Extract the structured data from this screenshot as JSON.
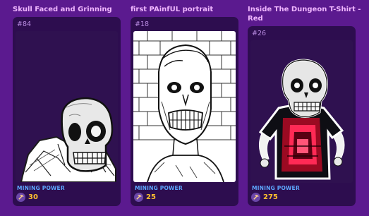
{
  "cards": [
    {
      "title": "Skull Faced and Grinning",
      "id": "#84",
      "mining_label": "MINING POWER",
      "mining_value": "30",
      "art": "skull-wrapped-in-cloth"
    },
    {
      "title": "first PAinfUL portrait",
      "id": "#18",
      "mining_label": "MINING POWER",
      "mining_value": "25",
      "art": "sketched-zombie-portrait"
    },
    {
      "title_lines": [
        "Inside The Dungeon T-Shirt -",
        "Red"
      ],
      "id": "#26",
      "mining_label": "MINING POWER",
      "mining_value": "275",
      "art": "skeleton-in-red-tshirt"
    }
  ],
  "colors": {
    "background": "#5b1a8f",
    "card": "#2d0d4f",
    "title": "#f0b7ff",
    "mining_label": "#5ea8ff",
    "mining_value": "#ffc02e"
  }
}
